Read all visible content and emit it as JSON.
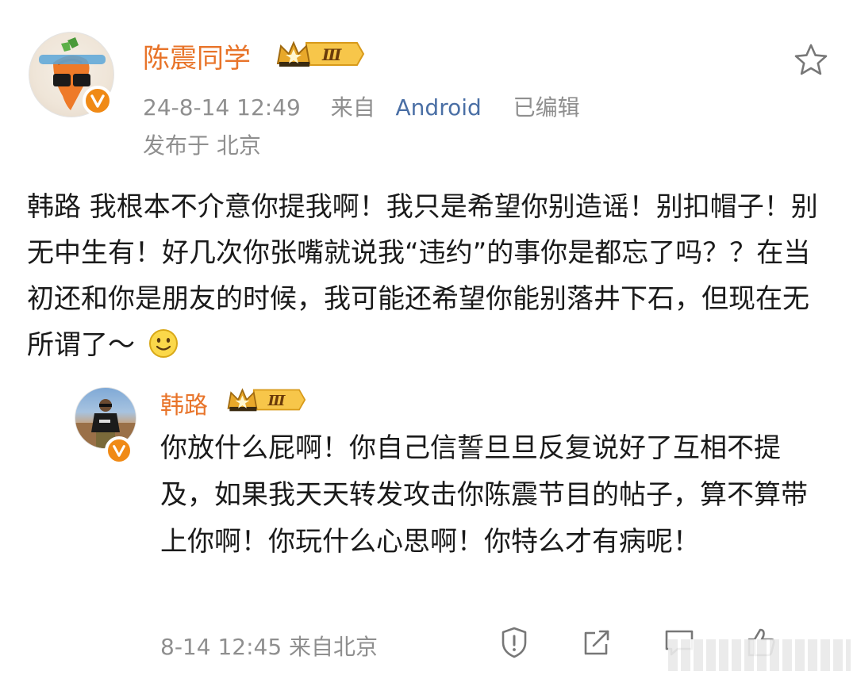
{
  "post": {
    "author": "陈震同学",
    "level_badge": "Ⅲ",
    "timestamp": "24-8-14 12:49",
    "source_prefix": "来自",
    "source": "Android",
    "edited": "已编辑",
    "location_label": "发布于 北京",
    "text": "韩路 我根本不介意你提我啊！我只是希望你别造谣！别扣帽子！别无中生有！好几次你张嘴就说我“违约”的事你是都忘了吗？？在当初还和你是朋友的时候，我可能还希望你能别落井下石，但现在无所谓了～"
  },
  "reply": {
    "author": "韩路",
    "level_badge": "Ⅲ",
    "text": "你放什么屁啊！你自己信誓旦旦反复说好了互相不提及，如果我天天转发攻击你陈震节目的帖子，算不算带上你啊！你玩什么心思啊！你特么才有病呢！",
    "meta": "8-14 12:45 来自北京"
  },
  "icons": {
    "favorite": "star-outline-icon",
    "verified": "verified-v-icon",
    "emoji": "smile-emoji-icon",
    "report": "report-icon",
    "share": "share-icon",
    "comment": "comment-icon",
    "like": "like-icon"
  },
  "colors": {
    "username": "#e8742a",
    "meta": "#8f8f8f",
    "link": "#4a6fa5",
    "verified": "#f08a16",
    "badge_gold": "#f2b53a"
  }
}
